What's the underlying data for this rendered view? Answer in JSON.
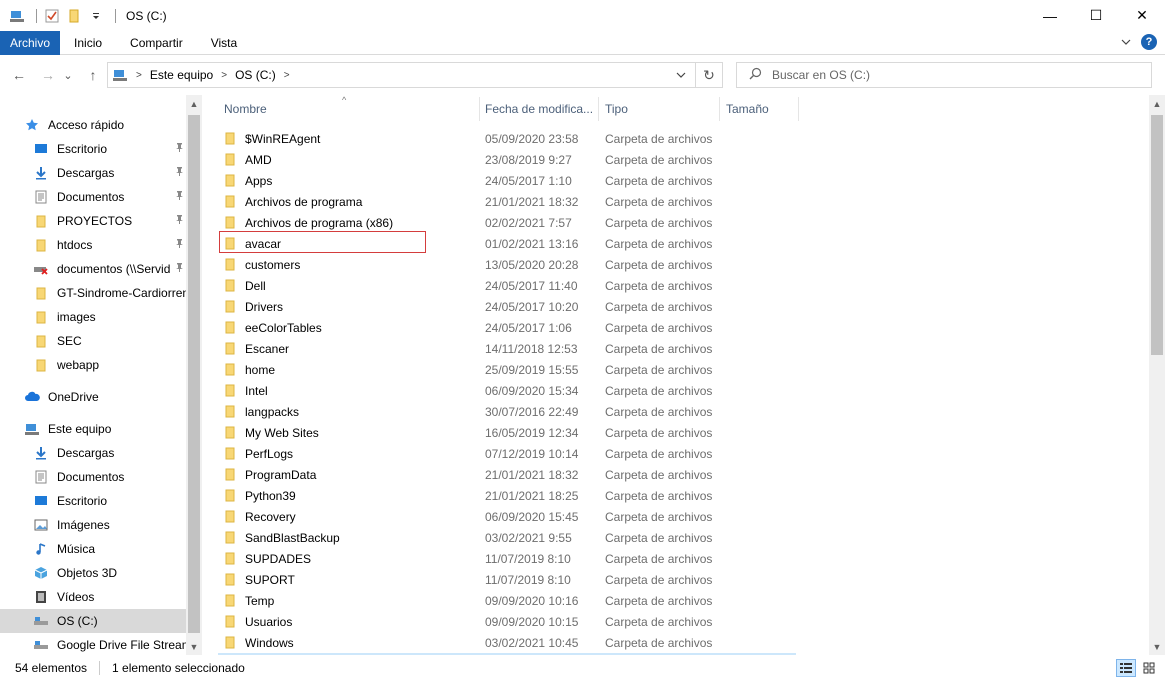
{
  "window": {
    "title": "OS (C:)",
    "minimize_glyph": "—",
    "maximize_glyph": "☐",
    "close_glyph": "✕"
  },
  "ribbon": {
    "tabs": [
      "Archivo",
      "Inicio",
      "Compartir",
      "Vista"
    ],
    "help_glyph": "?"
  },
  "navbar": {
    "back_glyph": "←",
    "forward_glyph": "→",
    "recent_glyph": "⌄",
    "up_glyph": "↑",
    "refresh_glyph": "↻",
    "breadcrumbs": [
      "Este equipo",
      "OS (C:)"
    ],
    "search_placeholder": "Buscar en OS (C:)"
  },
  "nav_pane": {
    "items": [
      {
        "label": "Acceso rápido",
        "icon": "star-icon",
        "indent": 0,
        "pinned": false
      },
      {
        "label": "Escritorio",
        "icon": "desktop-icon",
        "indent": 1,
        "pinned": true
      },
      {
        "label": "Descargas",
        "icon": "download-icon",
        "indent": 1,
        "pinned": true
      },
      {
        "label": "Documentos",
        "icon": "document-icon",
        "indent": 1,
        "pinned": true
      },
      {
        "label": "PROYECTOS",
        "icon": "folder-icon",
        "indent": 1,
        "pinned": true
      },
      {
        "label": "htdocs",
        "icon": "folder-icon",
        "indent": 1,
        "pinned": true
      },
      {
        "label": "documentos (\\\\Servid",
        "icon": "network-drive-disconnected-icon",
        "indent": 1,
        "pinned": true
      },
      {
        "label": "GT-Sindrome-Cardiorren",
        "icon": "folder-icon",
        "indent": 1,
        "pinned": false
      },
      {
        "label": "images",
        "icon": "folder-icon",
        "indent": 1,
        "pinned": false
      },
      {
        "label": "SEC",
        "icon": "folder-icon",
        "indent": 1,
        "pinned": false
      },
      {
        "label": "webapp",
        "icon": "folder-icon",
        "indent": 1,
        "pinned": false
      },
      {
        "label": "OneDrive",
        "icon": "cloud-icon",
        "indent": 0,
        "pinned": false
      },
      {
        "label": "Este equipo",
        "icon": "computer-icon",
        "indent": 0,
        "pinned": false
      },
      {
        "label": "Descargas",
        "icon": "download-icon",
        "indent": 1,
        "pinned": false
      },
      {
        "label": "Documentos",
        "icon": "document-icon",
        "indent": 1,
        "pinned": false
      },
      {
        "label": "Escritorio",
        "icon": "desktop-icon",
        "indent": 1,
        "pinned": false
      },
      {
        "label": "Imágenes",
        "icon": "pictures-icon",
        "indent": 1,
        "pinned": false
      },
      {
        "label": "Música",
        "icon": "music-icon",
        "indent": 1,
        "pinned": false
      },
      {
        "label": "Objetos 3D",
        "icon": "cube-icon",
        "indent": 1,
        "pinned": false
      },
      {
        "label": "Vídeos",
        "icon": "video-icon",
        "indent": 1,
        "pinned": false
      },
      {
        "label": "OS (C:)",
        "icon": "drive-icon",
        "indent": 1,
        "pinned": false,
        "selected": true
      },
      {
        "label": "Google Drive File Stream",
        "icon": "drive-icon",
        "indent": 1,
        "pinned": false
      }
    ],
    "pin_glyph": "📌"
  },
  "columns": {
    "name": "Nombre",
    "date": "Fecha de modifica...",
    "type": "Tipo",
    "size": "Tamaño",
    "sort_glyph": "^"
  },
  "files": [
    {
      "name": "$WinREAgent",
      "date": "05/09/2020 23:58",
      "type": "Carpeta de archivos"
    },
    {
      "name": "AMD",
      "date": "23/08/2019 9:27",
      "type": "Carpeta de archivos"
    },
    {
      "name": "Apps",
      "date": "24/05/2017 1:10",
      "type": "Carpeta de archivos"
    },
    {
      "name": "Archivos de programa",
      "date": "21/01/2021 18:32",
      "type": "Carpeta de archivos"
    },
    {
      "name": "Archivos de programa (x86)",
      "date": "02/02/2021 7:57",
      "type": "Carpeta de archivos"
    },
    {
      "name": "avacar",
      "date": "01/02/2021 13:16",
      "type": "Carpeta de archivos",
      "highlighted": true
    },
    {
      "name": "customers",
      "date": "13/05/2020 20:28",
      "type": "Carpeta de archivos"
    },
    {
      "name": "Dell",
      "date": "24/05/2017 11:40",
      "type": "Carpeta de archivos"
    },
    {
      "name": "Drivers",
      "date": "24/05/2017 10:20",
      "type": "Carpeta de archivos"
    },
    {
      "name": "eeColorTables",
      "date": "24/05/2017 1:06",
      "type": "Carpeta de archivos"
    },
    {
      "name": "Escaner",
      "date": "14/11/2018 12:53",
      "type": "Carpeta de archivos"
    },
    {
      "name": "home",
      "date": "25/09/2019 15:55",
      "type": "Carpeta de archivos"
    },
    {
      "name": "Intel",
      "date": "06/09/2020 15:34",
      "type": "Carpeta de archivos"
    },
    {
      "name": "langpacks",
      "date": "30/07/2016 22:49",
      "type": "Carpeta de archivos"
    },
    {
      "name": "My Web Sites",
      "date": "16/05/2019 12:34",
      "type": "Carpeta de archivos"
    },
    {
      "name": "PerfLogs",
      "date": "07/12/2019 10:14",
      "type": "Carpeta de archivos"
    },
    {
      "name": "ProgramData",
      "date": "21/01/2021 18:32",
      "type": "Carpeta de archivos"
    },
    {
      "name": "Python39",
      "date": "21/01/2021 18:25",
      "type": "Carpeta de archivos"
    },
    {
      "name": "Recovery",
      "date": "06/09/2020 15:45",
      "type": "Carpeta de archivos"
    },
    {
      "name": "SandBlastBackup",
      "date": "03/02/2021 9:55",
      "type": "Carpeta de archivos"
    },
    {
      "name": "SUPDADES",
      "date": "11/07/2019 8:10",
      "type": "Carpeta de archivos"
    },
    {
      "name": "SUPORT",
      "date": "11/07/2019 8:10",
      "type": "Carpeta de archivos"
    },
    {
      "name": "Temp",
      "date": "09/09/2020 10:16",
      "type": "Carpeta de archivos"
    },
    {
      "name": "Usuarios",
      "date": "09/09/2020 10:15",
      "type": "Carpeta de archivos"
    },
    {
      "name": "Windows",
      "date": "03/02/2021 10:45",
      "type": "Carpeta de archivos"
    }
  ],
  "status": {
    "count": "54 elementos",
    "selection": "1 elemento seleccionado"
  },
  "colors": {
    "accent": "#1a63b4",
    "folder": "#f8d775",
    "highlight_border": "#d43d3d",
    "meta_text": "#6d6d6d"
  }
}
